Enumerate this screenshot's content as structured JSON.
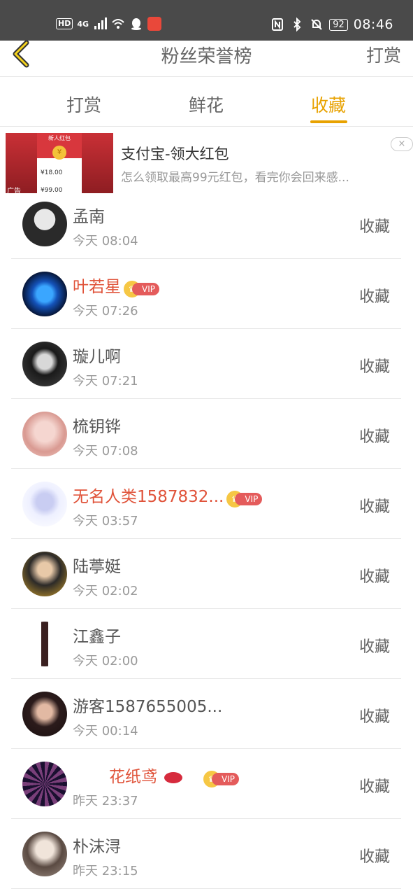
{
  "status_bar": {
    "hd": "HD",
    "net": "4G",
    "battery": "92",
    "time": "08:46"
  },
  "header": {
    "title": "粉丝荣誉榜",
    "right_action": "打赏"
  },
  "tabs": [
    {
      "label": "打赏",
      "active": false
    },
    {
      "label": "鲜花",
      "active": false
    },
    {
      "label": "收藏",
      "active": true
    }
  ],
  "ad": {
    "title": "支付宝-领大红包",
    "subtitle": "怎么领取最高99元红包，看完你会回来感...",
    "label": "广告",
    "card_title": "新人红包",
    "price1": "¥18.00",
    "price2": "¥99.00",
    "close": "×"
  },
  "colors": {
    "accent": "#e8a200",
    "vip_name": "#e0533a",
    "vip_tag": "#e45b5b"
  },
  "rows": [
    {
      "name": "孟南",
      "time": "今天 08:04",
      "action": "收藏",
      "vip": false
    },
    {
      "name": "叶若星",
      "time": "今天 07:26",
      "action": "收藏",
      "vip": true,
      "vip_text": "VIP"
    },
    {
      "name": "璇儿啊",
      "time": "今天 07:21",
      "action": "收藏",
      "vip": false
    },
    {
      "name": "梳钥铧",
      "time": "今天 07:08",
      "action": "收藏",
      "vip": false
    },
    {
      "name": "无名人类1587832...",
      "time": "今天 03:57",
      "action": "收藏",
      "vip": true,
      "vip_text": "VIP"
    },
    {
      "name": "陆葶娗",
      "time": "今天 02:02",
      "action": "收藏",
      "vip": false
    },
    {
      "name": "江鑫子",
      "time": "今天 02:00",
      "action": "收藏",
      "vip": false
    },
    {
      "name": "游客1587655005...",
      "time": "今天 00:14",
      "action": "收藏",
      "vip": false
    },
    {
      "name": "花纸鸢",
      "time": "昨天 23:37",
      "action": "收藏",
      "vip": true,
      "vip_text": "VIP"
    },
    {
      "name": "朴沫浔",
      "time": "昨天 23:15",
      "action": "收藏",
      "vip": false
    }
  ]
}
